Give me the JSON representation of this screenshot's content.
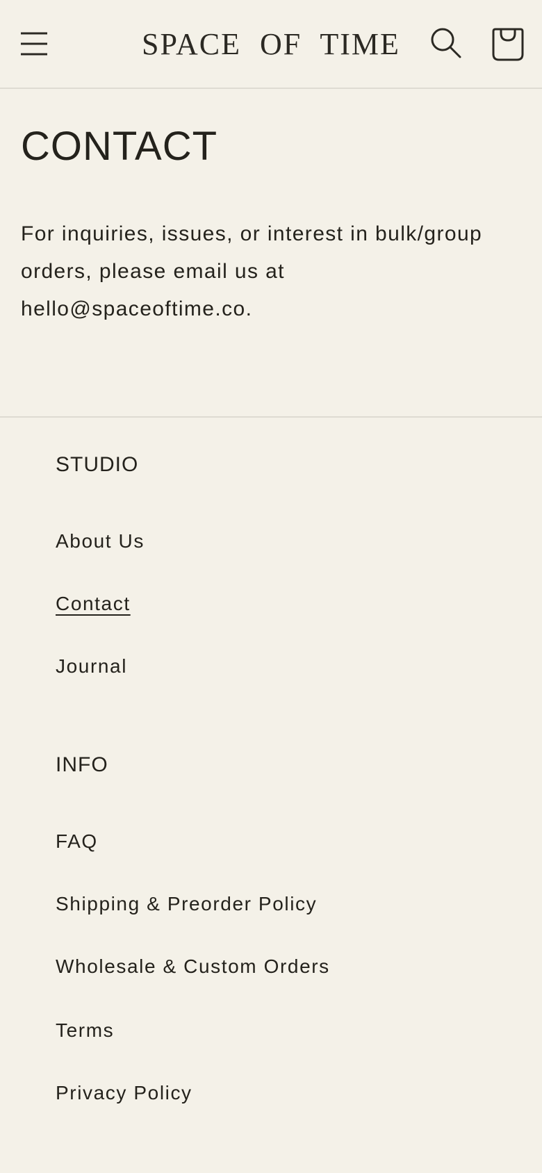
{
  "header": {
    "logo_text": "SPACE OF TIME",
    "menu_icon": "hamburger-menu-icon",
    "search_icon": "search-icon",
    "cart_icon": "shopping-bag-icon"
  },
  "main": {
    "title": "CONTACT",
    "body_text": "For inquiries, issues, or interest in bulk/group orders, please email us at hello@spaceoftime.co."
  },
  "footer": {
    "studio": {
      "heading": "STUDIO",
      "links": [
        "About Us",
        "Contact",
        "Journal"
      ]
    },
    "info": {
      "heading": "INFO",
      "links": [
        "FAQ",
        "Shipping & Preorder Policy",
        "Wholesale & Custom Orders",
        "Terms",
        "Privacy Policy"
      ]
    }
  },
  "colors": {
    "background": "#f4f1e8",
    "text": "#24221c",
    "divider": "#dedbd2"
  }
}
